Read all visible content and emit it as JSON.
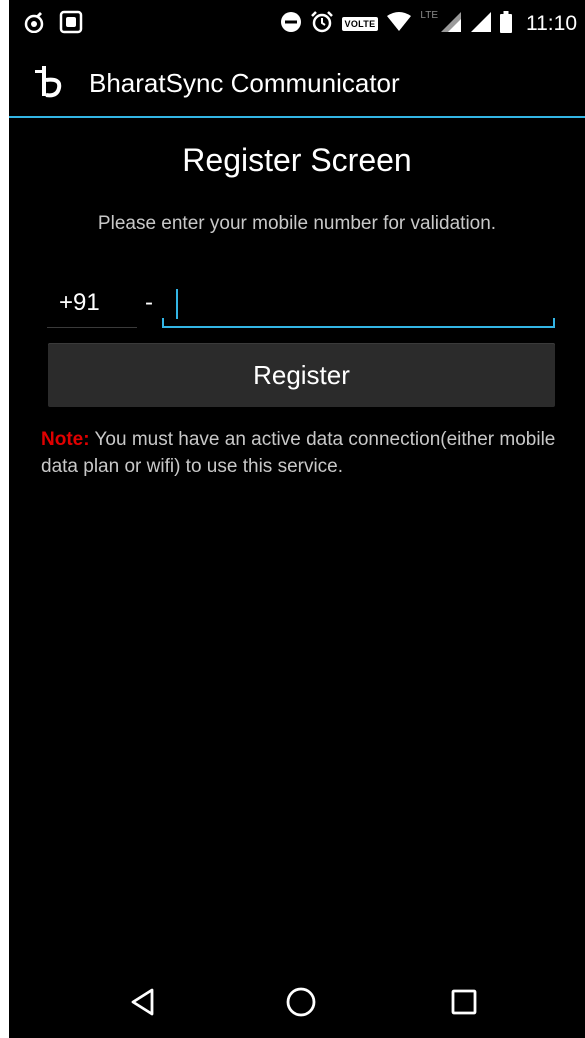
{
  "status_bar": {
    "time": "11:10",
    "volte_label": "VOLTE",
    "lte_label": "LTE",
    "icons": [
      "app-notification-icon",
      "screenshot-icon",
      "do-not-disturb-icon",
      "alarm-icon",
      "volte-icon",
      "wifi-icon",
      "signal-icon",
      "battery-icon"
    ]
  },
  "app_bar": {
    "title": "BharatSync Communicator",
    "logo_icon": "bharatsync-logo-icon"
  },
  "register": {
    "title": "Register Screen",
    "subtitle": "Please enter your mobile number for validation.",
    "country_code": "+91",
    "separator": "-",
    "phone_value": "",
    "button_label": "Register"
  },
  "note": {
    "label": "Note:",
    "text": " You must have an active data connection(either mobile data plan or wifi) to use this service."
  },
  "nav_bar": {
    "icons": [
      "back-icon",
      "home-icon",
      "recents-icon"
    ]
  },
  "colors": {
    "accent": "#33b5e5",
    "note_label": "#e00000",
    "background": "#000000",
    "button_bg": "#2b2b2b"
  }
}
